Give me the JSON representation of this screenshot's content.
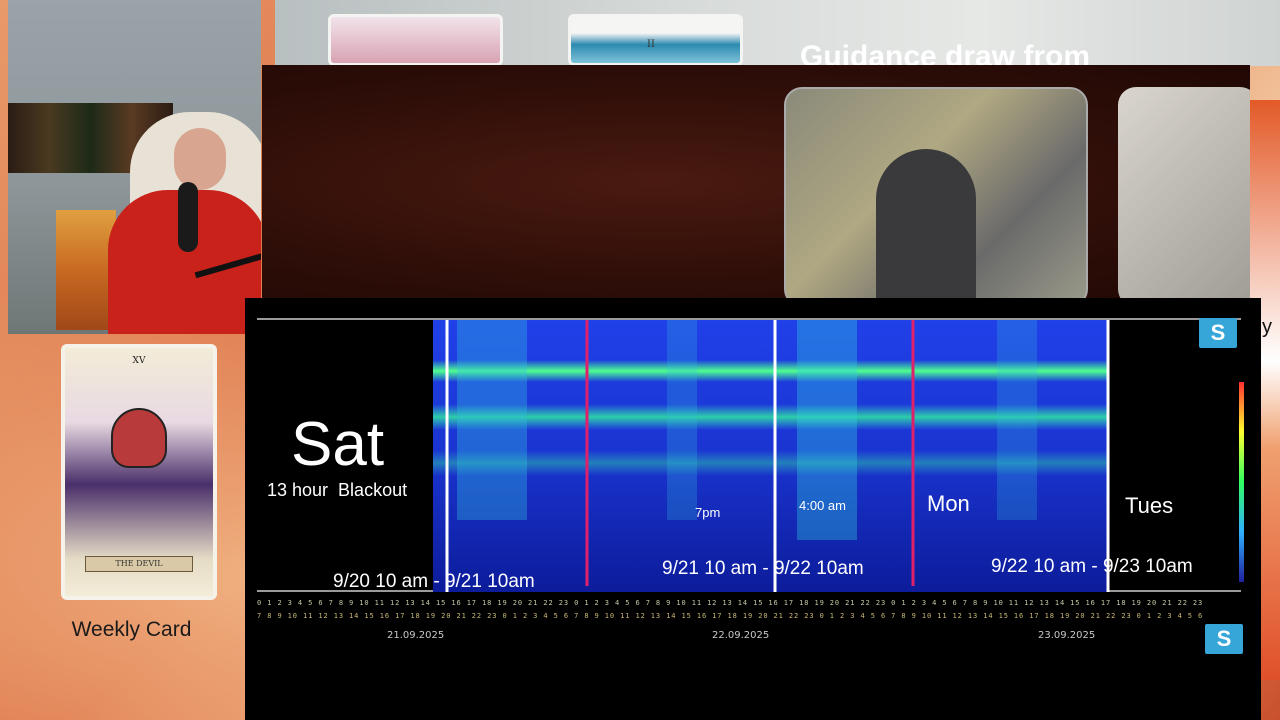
{
  "stream": {
    "top_title": "Guidance draw from",
    "mini_card_numeral": "II",
    "side_letter": "y"
  },
  "weekly": {
    "card_numeral": "XV",
    "card_name": "THE DEVIL",
    "label": "Weekly Card"
  },
  "spectrogram": {
    "day_start": "Sat",
    "blackout_note": "13 hour  Blackout",
    "day_labels": [
      "Mon",
      "Tues"
    ],
    "time_notes": [
      "7pm",
      "4:00 am"
    ],
    "ranges": [
      "9/20 10 am - 9/21 10am",
      "9/21 10 am - 9/22 10am",
      "9/22 10 am - 9/23 10am"
    ],
    "dates": [
      "21.09.2025",
      "22.09.2025",
      "23.09.2025"
    ],
    "hour_row_top": "0 1 2 3 4 5 6 7 8 9 10 11 12 13 14 15 16 17 18 19 20 21 22 23 0 1 2 3 4 5 6 7 8 9 10 11 12 13 14 15 16 17 18 19 20 21 22 23 0 1 2 3 4 5 6 7 8 9 10 11 12 13 14 15 16 17 18 19 20 21 22 23",
    "hour_row_bottom": "7 8 9 10 11 12 13 14 15 16 17 18 19 20 21 22 23 0 1 2 3 4 5 6 7 8 9 10 11 12 13 14 15 16 17 18 19 20 21 22 23 0 1 2 3 4 5 6 7 8 9 10 11 12 13 14 15 16 17 18 19 20 21 22 23 0 1 2 3 4 5 6",
    "logo_letter": "S",
    "colors": {
      "background": "#000000",
      "marker_white": "#ffffff",
      "marker_magenta": "#e0206a",
      "band": "#40ff90",
      "field": "#1030d0"
    }
  }
}
